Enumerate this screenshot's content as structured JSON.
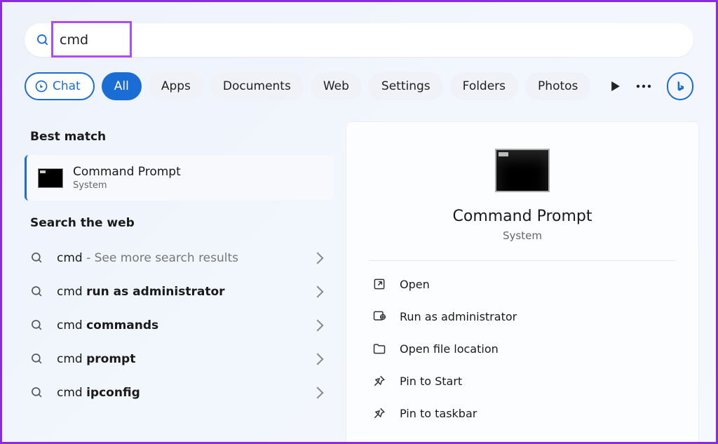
{
  "search": {
    "value": "cmd"
  },
  "filters": {
    "chat": "Chat",
    "items": [
      "All",
      "Apps",
      "Documents",
      "Web",
      "Settings",
      "Folders",
      "Photos"
    ],
    "active_index": 0
  },
  "left": {
    "best_match_header": "Best match",
    "best_match": {
      "title": "Command Prompt",
      "subtitle": "System"
    },
    "web_header": "Search the web",
    "web_items": [
      {
        "prefix": "cmd",
        "bold": "",
        "hint": " - See more search results"
      },
      {
        "prefix": "cmd ",
        "bold": "run as administrator",
        "hint": ""
      },
      {
        "prefix": "cmd ",
        "bold": "commands",
        "hint": ""
      },
      {
        "prefix": "cmd ",
        "bold": "prompt",
        "hint": ""
      },
      {
        "prefix": "cmd ",
        "bold": "ipconfig",
        "hint": ""
      }
    ]
  },
  "detail": {
    "title": "Command Prompt",
    "subtitle": "System",
    "actions": [
      {
        "icon": "open",
        "label": "Open"
      },
      {
        "icon": "admin",
        "label": "Run as administrator"
      },
      {
        "icon": "folder",
        "label": "Open file location"
      },
      {
        "icon": "pin",
        "label": "Pin to Start"
      },
      {
        "icon": "pin",
        "label": "Pin to taskbar"
      }
    ]
  }
}
